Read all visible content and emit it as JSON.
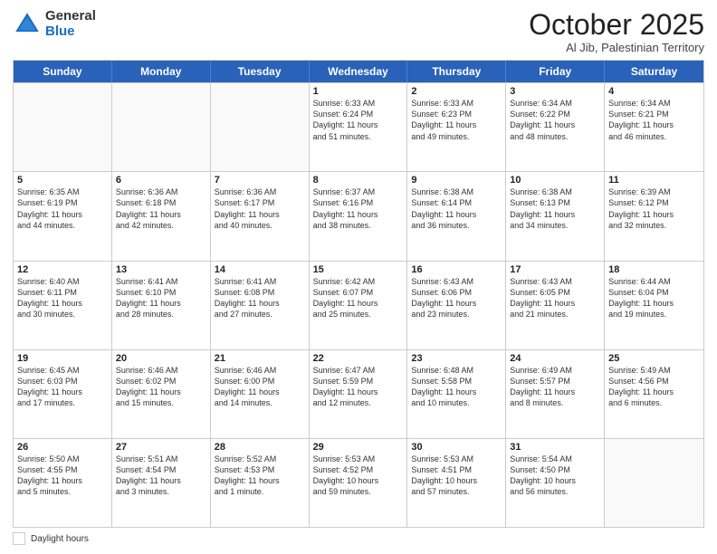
{
  "logo": {
    "general": "General",
    "blue": "Blue"
  },
  "header": {
    "month": "October 2025",
    "location": "Al Jib, Palestinian Territory"
  },
  "weekdays": [
    "Sunday",
    "Monday",
    "Tuesday",
    "Wednesday",
    "Thursday",
    "Friday",
    "Saturday"
  ],
  "weeks": [
    [
      {
        "day": "",
        "info": ""
      },
      {
        "day": "",
        "info": ""
      },
      {
        "day": "",
        "info": ""
      },
      {
        "day": "1",
        "info": "Sunrise: 6:33 AM\nSunset: 6:24 PM\nDaylight: 11 hours\nand 51 minutes."
      },
      {
        "day": "2",
        "info": "Sunrise: 6:33 AM\nSunset: 6:23 PM\nDaylight: 11 hours\nand 49 minutes."
      },
      {
        "day": "3",
        "info": "Sunrise: 6:34 AM\nSunset: 6:22 PM\nDaylight: 11 hours\nand 48 minutes."
      },
      {
        "day": "4",
        "info": "Sunrise: 6:34 AM\nSunset: 6:21 PM\nDaylight: 11 hours\nand 46 minutes."
      }
    ],
    [
      {
        "day": "5",
        "info": "Sunrise: 6:35 AM\nSunset: 6:19 PM\nDaylight: 11 hours\nand 44 minutes."
      },
      {
        "day": "6",
        "info": "Sunrise: 6:36 AM\nSunset: 6:18 PM\nDaylight: 11 hours\nand 42 minutes."
      },
      {
        "day": "7",
        "info": "Sunrise: 6:36 AM\nSunset: 6:17 PM\nDaylight: 11 hours\nand 40 minutes."
      },
      {
        "day": "8",
        "info": "Sunrise: 6:37 AM\nSunset: 6:16 PM\nDaylight: 11 hours\nand 38 minutes."
      },
      {
        "day": "9",
        "info": "Sunrise: 6:38 AM\nSunset: 6:14 PM\nDaylight: 11 hours\nand 36 minutes."
      },
      {
        "day": "10",
        "info": "Sunrise: 6:38 AM\nSunset: 6:13 PM\nDaylight: 11 hours\nand 34 minutes."
      },
      {
        "day": "11",
        "info": "Sunrise: 6:39 AM\nSunset: 6:12 PM\nDaylight: 11 hours\nand 32 minutes."
      }
    ],
    [
      {
        "day": "12",
        "info": "Sunrise: 6:40 AM\nSunset: 6:11 PM\nDaylight: 11 hours\nand 30 minutes."
      },
      {
        "day": "13",
        "info": "Sunrise: 6:41 AM\nSunset: 6:10 PM\nDaylight: 11 hours\nand 28 minutes."
      },
      {
        "day": "14",
        "info": "Sunrise: 6:41 AM\nSunset: 6:08 PM\nDaylight: 11 hours\nand 27 minutes."
      },
      {
        "day": "15",
        "info": "Sunrise: 6:42 AM\nSunset: 6:07 PM\nDaylight: 11 hours\nand 25 minutes."
      },
      {
        "day": "16",
        "info": "Sunrise: 6:43 AM\nSunset: 6:06 PM\nDaylight: 11 hours\nand 23 minutes."
      },
      {
        "day": "17",
        "info": "Sunrise: 6:43 AM\nSunset: 6:05 PM\nDaylight: 11 hours\nand 21 minutes."
      },
      {
        "day": "18",
        "info": "Sunrise: 6:44 AM\nSunset: 6:04 PM\nDaylight: 11 hours\nand 19 minutes."
      }
    ],
    [
      {
        "day": "19",
        "info": "Sunrise: 6:45 AM\nSunset: 6:03 PM\nDaylight: 11 hours\nand 17 minutes."
      },
      {
        "day": "20",
        "info": "Sunrise: 6:46 AM\nSunset: 6:02 PM\nDaylight: 11 hours\nand 15 minutes."
      },
      {
        "day": "21",
        "info": "Sunrise: 6:46 AM\nSunset: 6:00 PM\nDaylight: 11 hours\nand 14 minutes."
      },
      {
        "day": "22",
        "info": "Sunrise: 6:47 AM\nSunset: 5:59 PM\nDaylight: 11 hours\nand 12 minutes."
      },
      {
        "day": "23",
        "info": "Sunrise: 6:48 AM\nSunset: 5:58 PM\nDaylight: 11 hours\nand 10 minutes."
      },
      {
        "day": "24",
        "info": "Sunrise: 6:49 AM\nSunset: 5:57 PM\nDaylight: 11 hours\nand 8 minutes."
      },
      {
        "day": "25",
        "info": "Sunrise: 5:49 AM\nSunset: 4:56 PM\nDaylight: 11 hours\nand 6 minutes."
      }
    ],
    [
      {
        "day": "26",
        "info": "Sunrise: 5:50 AM\nSunset: 4:55 PM\nDaylight: 11 hours\nand 5 minutes."
      },
      {
        "day": "27",
        "info": "Sunrise: 5:51 AM\nSunset: 4:54 PM\nDaylight: 11 hours\nand 3 minutes."
      },
      {
        "day": "28",
        "info": "Sunrise: 5:52 AM\nSunset: 4:53 PM\nDaylight: 11 hours\nand 1 minute."
      },
      {
        "day": "29",
        "info": "Sunrise: 5:53 AM\nSunset: 4:52 PM\nDaylight: 10 hours\nand 59 minutes."
      },
      {
        "day": "30",
        "info": "Sunrise: 5:53 AM\nSunset: 4:51 PM\nDaylight: 10 hours\nand 57 minutes."
      },
      {
        "day": "31",
        "info": "Sunrise: 5:54 AM\nSunset: 4:50 PM\nDaylight: 10 hours\nand 56 minutes."
      },
      {
        "day": "",
        "info": ""
      }
    ]
  ],
  "footer": {
    "box_label": "Daylight hours"
  }
}
